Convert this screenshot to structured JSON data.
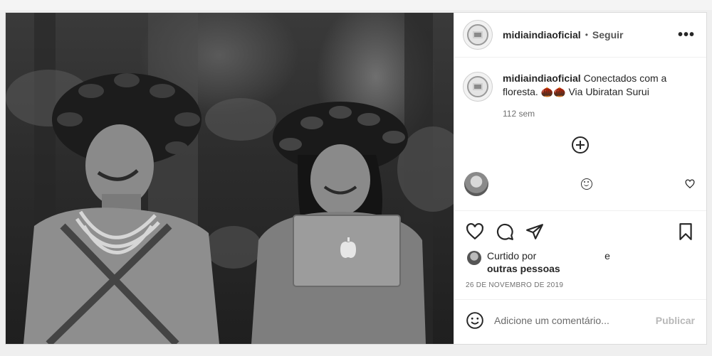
{
  "post": {
    "username": "midiaindiaoficial",
    "dot": "•",
    "follow_label": "Seguir",
    "more_label": "•••",
    "caption_text": "Conectados com a floresta. 🌰🌰 Via Ubiratan Surui",
    "caption_time": "112 sem",
    "liked_by_prefix": "Curtido por",
    "liked_by_and": "e",
    "liked_by_others": "outras pessoas",
    "date": "26 DE NOVEMBRO DE 2019",
    "comment_placeholder": "Adicione um comentário...",
    "publish_label": "Publicar"
  },
  "icons": {
    "like": "heart-icon",
    "comment": "comment-icon",
    "share": "paper-plane-icon",
    "save": "bookmark-icon",
    "load_more": "plus-circle-icon",
    "emoji": "smile-icon"
  },
  "colors": {
    "text": "#262626",
    "muted": "#707070",
    "border": "#dbdbdb",
    "publish_disabled": "#b8b8b8"
  }
}
